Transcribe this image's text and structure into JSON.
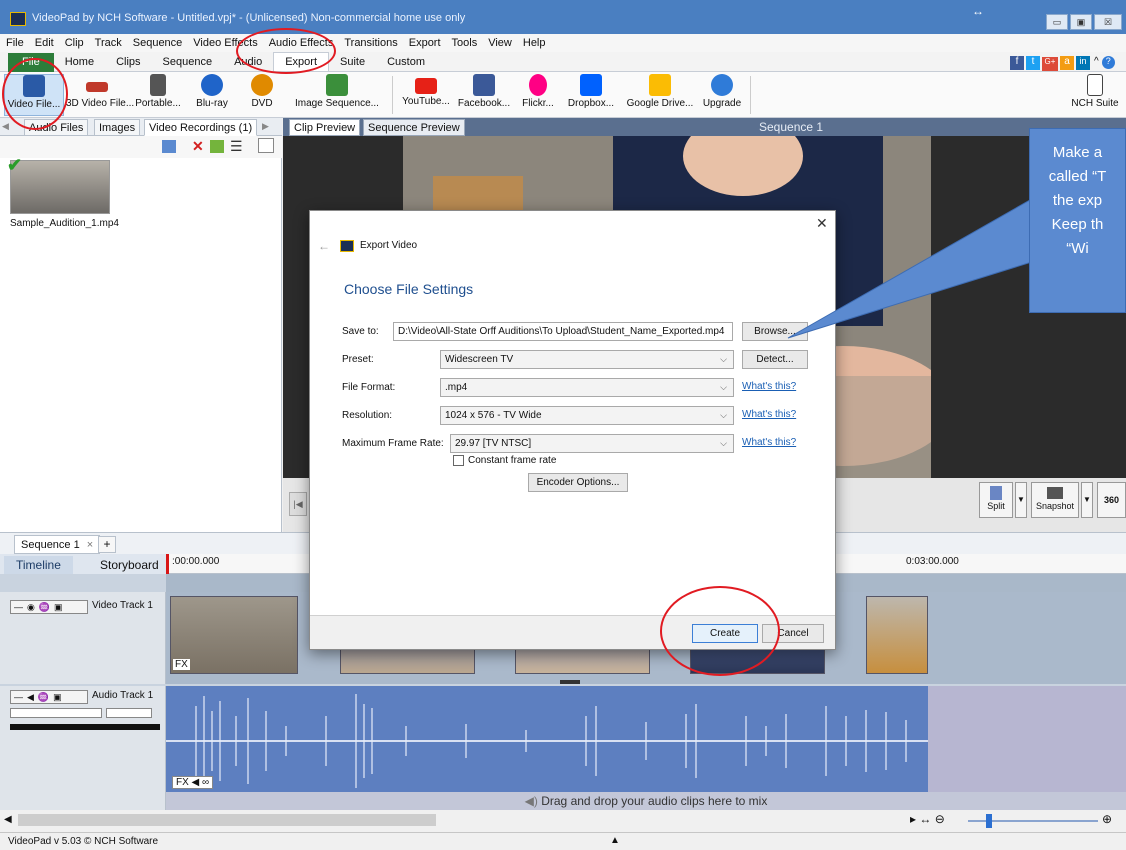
{
  "window": {
    "title": "VideoPad by NCH Software - Untitled.vpj* - (Unlicensed) Non-commercial home use only",
    "resize_glyph": "↔",
    "controls": [
      "▭",
      "▣",
      "☒"
    ]
  },
  "menu": [
    "File",
    "Edit",
    "Clip",
    "Track",
    "Sequence",
    "Video Effects",
    "Audio Effects",
    "Transitions",
    "Export",
    "Tools",
    "View",
    "Help"
  ],
  "ribbon_tabs": [
    "File",
    "Home",
    "Clips",
    "Sequence",
    "Audio",
    "Export",
    "Suite",
    "Custom"
  ],
  "ribbon_right": [
    "f",
    "t",
    "G+",
    "a",
    "in",
    "^",
    "?"
  ],
  "toolbar": [
    {
      "label": "Video File...",
      "icon": "film-icon",
      "color": "#2a5aa6"
    },
    {
      "label": "3D Video File...",
      "icon": "3d-glasses-icon",
      "color": "#c0392b"
    },
    {
      "label": "Portable...",
      "icon": "phone-icon",
      "color": "#555555"
    },
    {
      "label": "Blu-ray",
      "icon": "bluray-icon",
      "color": "#1f64c9"
    },
    {
      "label": "DVD",
      "icon": "dvd-icon",
      "color": "#e08a00"
    },
    {
      "label": "Image Sequence...",
      "icon": "images-icon",
      "color": "#3b8f3b"
    },
    {
      "label": "YouTube...",
      "icon": "youtube-icon",
      "color": "#e62117"
    },
    {
      "label": "Facebook...",
      "icon": "facebook-icon",
      "color": "#3b5998"
    },
    {
      "label": "Flickr...",
      "icon": "flickr-icon",
      "color": "#ff0084"
    },
    {
      "label": "Dropbox...",
      "icon": "dropbox-icon",
      "color": "#0061fe"
    },
    {
      "label": "Google Drive...",
      "icon": "gdrive-icon",
      "color": "#fbbc04"
    },
    {
      "label": "Upgrade",
      "icon": "upgrade-icon",
      "color": "#2f7bd8"
    },
    {
      "label": "NCH Suite",
      "icon": "nch-suite-icon",
      "color": "#444444"
    }
  ],
  "left_panel": {
    "tabs": [
      "Audio Files",
      "Images",
      "Video Recordings (1)"
    ],
    "clip_name": "Sample_Audition_1.mp4"
  },
  "preview": {
    "tabs": [
      "Clip Preview",
      "Sequence Preview"
    ],
    "title": "Sequence 1",
    "buttons": [
      "Split",
      "Snapshot",
      "360"
    ]
  },
  "sequence_tab": {
    "label": "Sequence 1",
    "close": "×",
    "add": "+"
  },
  "timeline": {
    "tabs": [
      "Timeline",
      "Storyboard"
    ],
    "start_time": ":00:00.000",
    "end_time": "0:03:00.000",
    "video_track": "Video Track 1",
    "audio_track": "Audio Track 1",
    "fx": "FX",
    "drop_hint": "Drag and drop your audio clips here to mix"
  },
  "dialog": {
    "title": "Export Video",
    "heading": "Choose File Settings",
    "save_to_label": "Save to:",
    "save_to_value": "D:\\Video\\All-State Orff Auditions\\To Upload\\Student_Name_Exported.mp4",
    "browse": "Browse...",
    "preset_label": "Preset:",
    "preset_value": "Widescreen TV",
    "detect": "Detect...",
    "format_label": "File Format:",
    "format_value": ".mp4",
    "whats_this": "What's this?",
    "resolution_label": "Resolution:",
    "resolution_value": "1024 x 576 - TV Wide",
    "framerate_label": "Maximum Frame Rate:",
    "framerate_value": "29.97 [TV NTSC]",
    "constant_label": "Constant frame rate",
    "encoder": "Encoder Options...",
    "create": "Create",
    "cancel": "Cancel"
  },
  "callout": {
    "lines": [
      "Make a",
      "called “T",
      "the exp",
      "Keep th",
      "“Wi"
    ]
  },
  "status": {
    "version": "VideoPad v 5.03 © NCH Software"
  }
}
